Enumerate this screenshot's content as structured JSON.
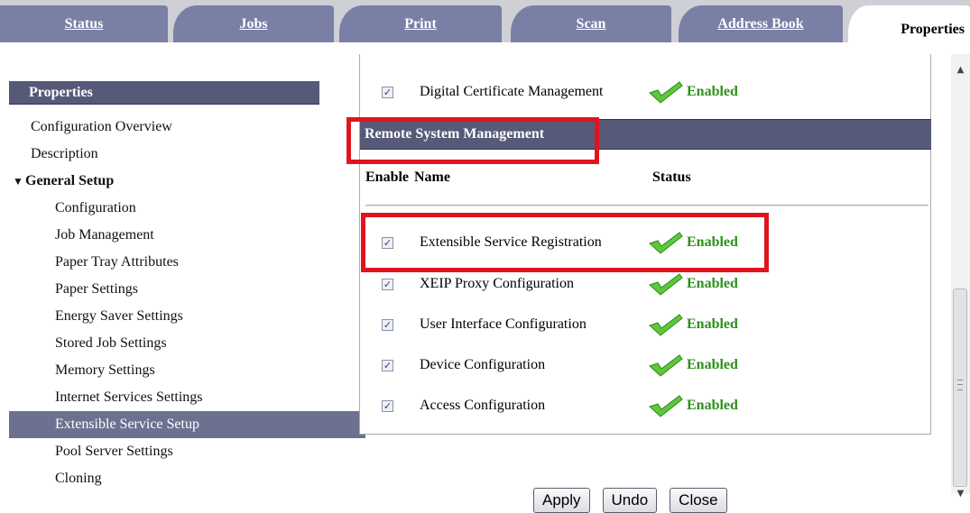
{
  "tabs": [
    {
      "label": "Status"
    },
    {
      "label": "Jobs"
    },
    {
      "label": "Print"
    },
    {
      "label": "Scan"
    },
    {
      "label": "Address Book"
    },
    {
      "label": "Properties"
    }
  ],
  "sidebar": {
    "header": "Properties",
    "items": [
      {
        "label": "Configuration Overview"
      },
      {
        "label": "Description"
      },
      {
        "label": "General Setup"
      },
      {
        "label": "Configuration"
      },
      {
        "label": "Job Management"
      },
      {
        "label": "Paper Tray Attributes"
      },
      {
        "label": "Paper Settings"
      },
      {
        "label": "Energy Saver Settings"
      },
      {
        "label": "Stored Job Settings"
      },
      {
        "label": "Memory Settings"
      },
      {
        "label": "Internet Services Settings"
      },
      {
        "label": "Extensible Service Setup"
      },
      {
        "label": "Pool Server Settings"
      },
      {
        "label": "Cloning"
      }
    ]
  },
  "main": {
    "top_row": {
      "name": "Digital Certificate Management",
      "status": "Enabled",
      "checked": true
    },
    "section_title": "Remote System Management",
    "columns": {
      "enable": "Enable",
      "name": "Name",
      "status": "Status"
    },
    "rows": [
      {
        "name": "Extensible Service Registration",
        "status": "Enabled",
        "checked": true
      },
      {
        "name": "XEIP Proxy Configuration",
        "status": "Enabled",
        "checked": true
      },
      {
        "name": "User Interface Configuration",
        "status": "Enabled",
        "checked": true
      },
      {
        "name": "Device Configuration",
        "status": "Enabled",
        "checked": true
      },
      {
        "name": "Access Configuration",
        "status": "Enabled",
        "checked": true
      }
    ],
    "buttons": {
      "apply": "Apply",
      "undo": "Undo",
      "close": "Close"
    }
  },
  "icons": {
    "check": "check-mark-icon",
    "checkbox": "checkbox-checked-icon",
    "collapse": "triangle-down-icon"
  },
  "colors": {
    "tab": "#7a7fa5",
    "header_bar": "#565a78",
    "active_nav": "#6c7190",
    "status": "#2f8f1c",
    "highlight": "#e0141e"
  }
}
